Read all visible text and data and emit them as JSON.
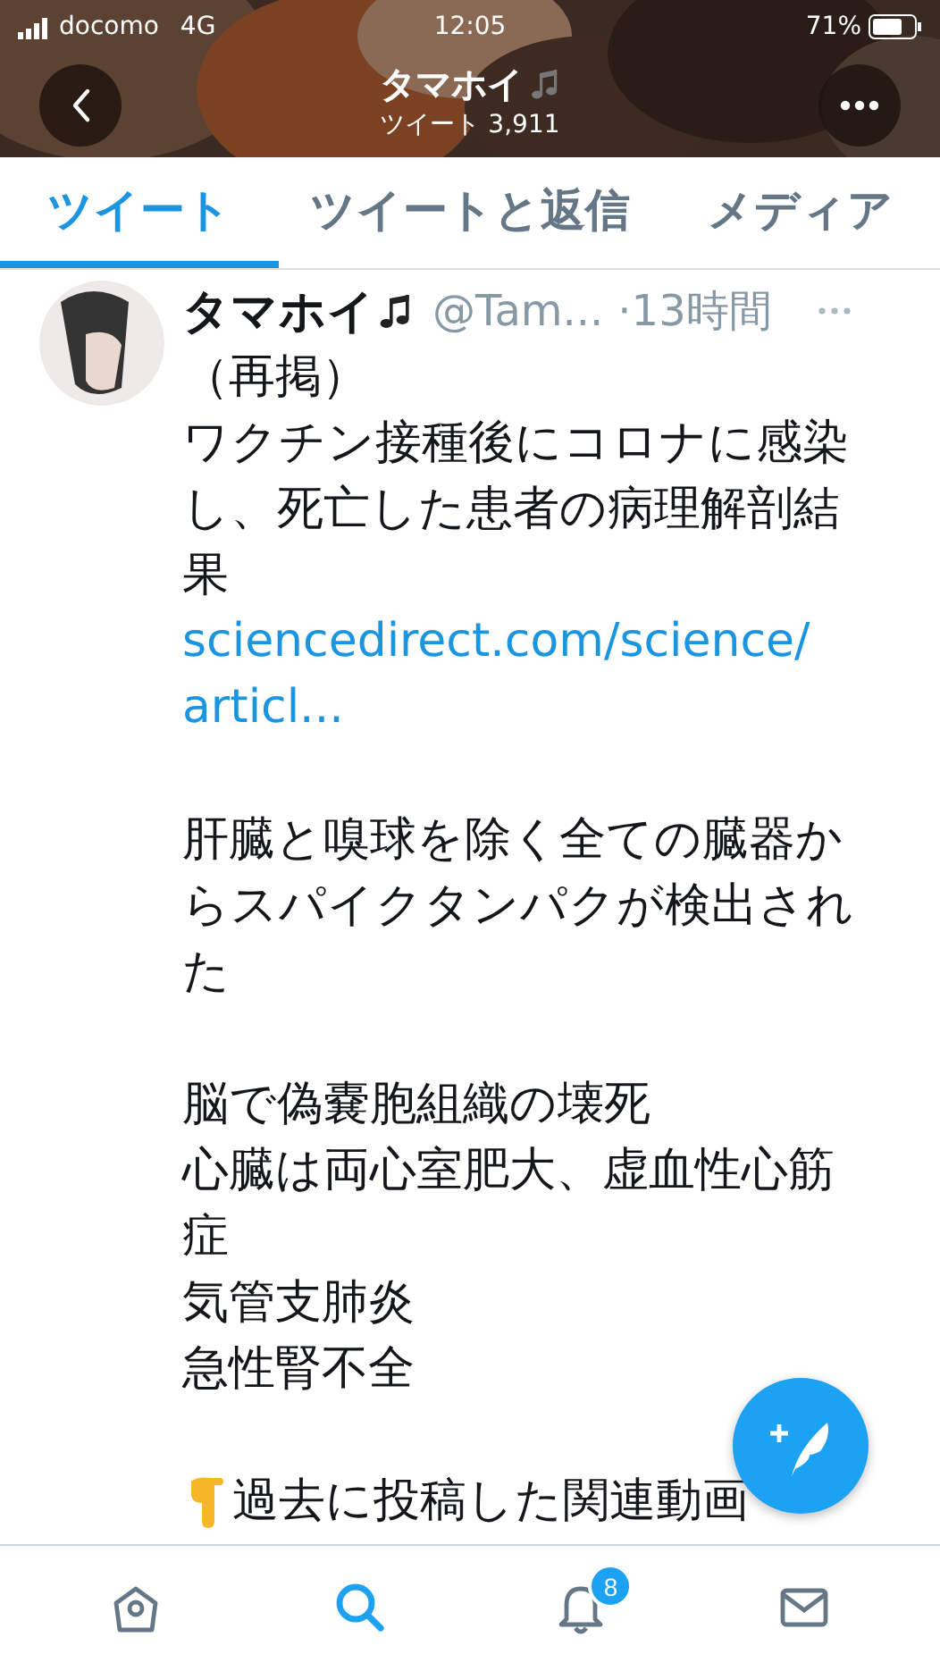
{
  "status_bar": {
    "carrier": "docomo",
    "network": "4G",
    "time": "12:05",
    "battery": "71%"
  },
  "header": {
    "title": "タマホイ",
    "subtitle": "ツイート 3,911"
  },
  "tabs": [
    {
      "label": "ツイート",
      "selected": true
    },
    {
      "label": "ツイートと返信",
      "selected": false
    },
    {
      "label": "メディア",
      "selected": false
    }
  ],
  "tweet": {
    "name": "タマホイ",
    "handle": "@Tam...",
    "time": "·13時間",
    "body": [
      {
        "lines": [
          {
            "kind": "text",
            "text": "（再掲）"
          },
          {
            "kind": "text",
            "text": "ワクチン接種後にコロナに感染し、死亡した患者の病理解剖結果"
          },
          {
            "kind": "link",
            "text": "sciencedirect.com/science/articl..."
          }
        ]
      },
      {
        "lines": [
          {
            "kind": "text",
            "text": "肝臓と嗅球を除く全ての臓器からスパイクタンパクが検出された"
          }
        ]
      },
      {
        "lines": [
          {
            "kind": "text",
            "text": "脳で偽嚢胞組織の壊死"
          },
          {
            "kind": "text",
            "text": "心臓は両心室肥大、虚血性心筋症"
          },
          {
            "kind": "text",
            "text": "気管支肺炎"
          },
          {
            "kind": "text",
            "text": "急性腎不全"
          }
        ]
      },
      {
        "lines": [
          {
            "kind": "pointer",
            "text": "過去に投稿した関連動画"
          }
        ]
      }
    ]
  },
  "nav": [
    {
      "kind": "home",
      "selected": false
    },
    {
      "kind": "search",
      "selected": true
    },
    {
      "kind": "bell",
      "selected": false,
      "badge": "8"
    },
    {
      "kind": "mail",
      "selected": false
    }
  ]
}
